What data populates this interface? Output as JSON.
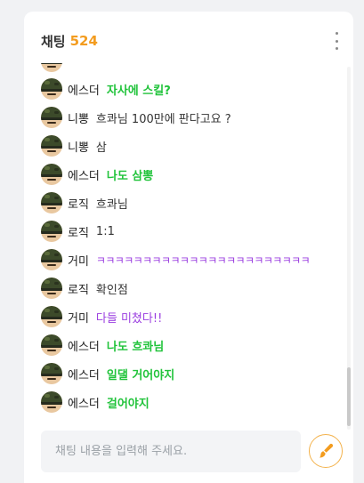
{
  "chat": {
    "title": "채팅",
    "count": "524",
    "input_placeholder": "채팅 내용을 입력해 주세요.",
    "colors": {
      "accent": "#f39c1f",
      "green": "#20c33a",
      "purple": "#9b3fe0"
    },
    "messages": [
      {
        "nick": "에스더",
        "text": "자사에 스킬?",
        "style": "green"
      },
      {
        "nick": "니뽕",
        "text": "흐콰님 100만에 판다고요 ?",
        "style": "normal"
      },
      {
        "nick": "니뽕",
        "text": "삼",
        "style": "normal"
      },
      {
        "nick": "에스더",
        "text": "나도 삼뽕",
        "style": "green"
      },
      {
        "nick": "로직",
        "text": "흐콰님",
        "style": "normal"
      },
      {
        "nick": "로직",
        "text": "1:1",
        "style": "normal"
      },
      {
        "nick": "거미",
        "text": "ㅋㅋㅋㅋㅋㅋㅋㅋㅋㅋㅋㅋㅋㅋㅋㅋㅋㅋㅋㅋㅋㅋㅋ",
        "style": "purple"
      },
      {
        "nick": "로직",
        "text": "확인점",
        "style": "normal"
      },
      {
        "nick": "거미",
        "text": "다들 미쳤다!!",
        "style": "purple"
      },
      {
        "nick": "에스더",
        "text": "나도 흐콰님",
        "style": "green"
      },
      {
        "nick": "에스더",
        "text": "일댈 거어야지",
        "style": "green"
      },
      {
        "nick": "에스더",
        "text": "걸어야지",
        "style": "green"
      }
    ]
  },
  "icons": {
    "more": "more-vertical-icon",
    "send": "paint-brush-icon",
    "avatar": "soldier-avatar-icon"
  }
}
